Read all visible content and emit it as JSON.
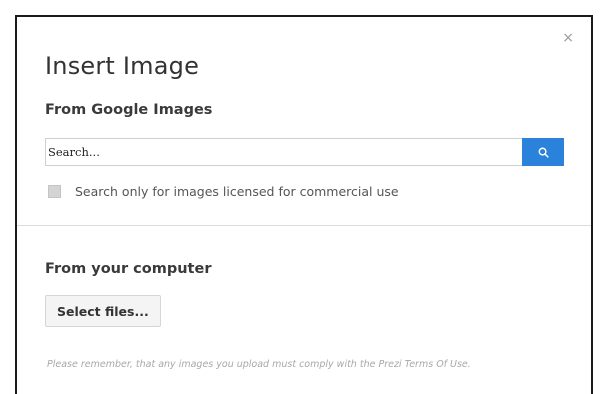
{
  "dialog": {
    "title": "Insert Image",
    "close_symbol": "×",
    "google_section": {
      "heading": "From Google Images",
      "search_placeholder": "Search...",
      "search_value": "",
      "search_button_icon": "search-icon",
      "commercial_checkbox_label": "Search only for images licensed for commercial use",
      "commercial_checkbox_checked": false
    },
    "computer_section": {
      "heading": "From your computer",
      "select_files_label": "Select files..."
    },
    "notice": "Please remember, that any images you upload must comply with the Prezi Terms Of Use."
  },
  "colors": {
    "accent": "#2a82da",
    "text": "#333333",
    "muted": "#a8a8a8"
  }
}
